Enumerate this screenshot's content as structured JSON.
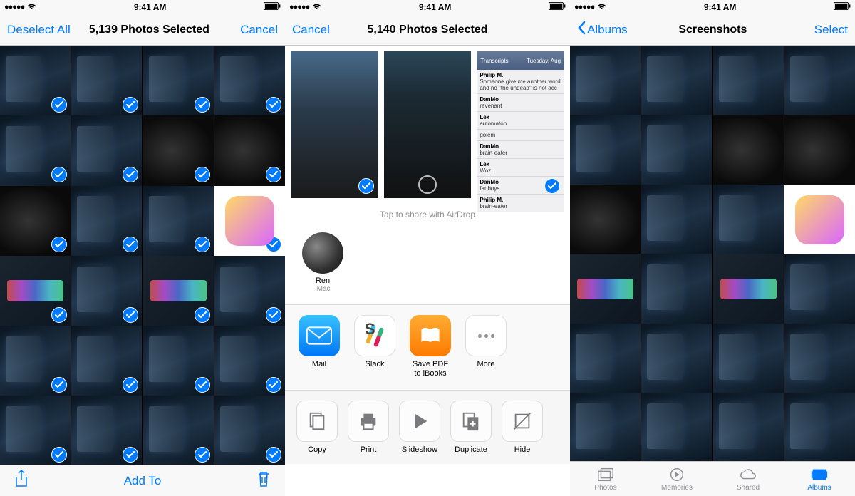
{
  "status": {
    "time": "9:41 AM"
  },
  "screen1": {
    "deselect": "Deselect All",
    "title": "5,139 Photos Selected",
    "cancel": "Cancel",
    "add_to": "Add To"
  },
  "screen2": {
    "cancel": "Cancel",
    "title": "5,140 Photos Selected",
    "airdrop_hint": "Tap to share with AirDrop",
    "airdrop": {
      "name": "Ren",
      "device": "iMac"
    },
    "apps": [
      {
        "label": "Mail"
      },
      {
        "label": "Slack"
      },
      {
        "label": "Save PDF to iBooks"
      },
      {
        "label": "More"
      }
    ],
    "actions": [
      {
        "label": "Copy"
      },
      {
        "label": "Print"
      },
      {
        "label": "Slideshow"
      },
      {
        "label": "Duplicate"
      },
      {
        "label": "Hide"
      }
    ],
    "preview_c": {
      "header_left": "Transcripts",
      "header_right": "Tuesday, Aug",
      "rows": [
        {
          "name": "Philip M.",
          "text": "Someone give me another word and no \"the undead\" is not acc"
        },
        {
          "name": "DanMo",
          "text": "revenant"
        },
        {
          "name": "Lex",
          "text": "automaton"
        },
        {
          "name": "",
          "text": "golem"
        },
        {
          "name": "DanMo",
          "text": "brain-eater"
        },
        {
          "name": "Lex",
          "text": "Woz"
        },
        {
          "name": "DanMo",
          "text": "fanboys"
        },
        {
          "name": "Philip M.",
          "text": "brain-eater"
        }
      ]
    }
  },
  "screen3": {
    "back": "Albums",
    "title": "Screenshots",
    "select": "Select",
    "tabs": [
      {
        "label": "Photos"
      },
      {
        "label": "Memories"
      },
      {
        "label": "Shared"
      },
      {
        "label": "Albums"
      }
    ]
  }
}
